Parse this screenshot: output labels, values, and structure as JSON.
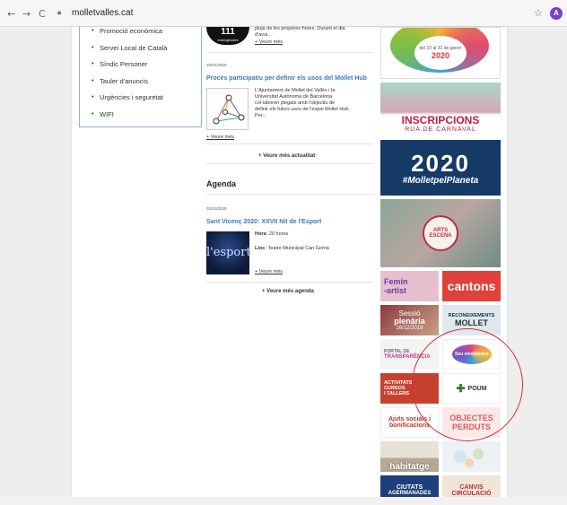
{
  "browser": {
    "url": "molletvalles.cat",
    "avatar_initial": "A",
    "back_icon": "←",
    "forward_icon": "→",
    "reload_icon": "C",
    "star_icon": "☆"
  },
  "leftmenu": {
    "items": [
      {
        "label": "Promoció econòmica"
      },
      {
        "label": "Servei Local de Català"
      },
      {
        "label": "Síndic Personer"
      },
      {
        "label": "Tauler d'anuncis"
      },
      {
        "label": "Urgències i seguretat"
      },
      {
        "label": "WIFI"
      }
    ]
  },
  "news": {
    "top_item": {
      "thumb_text": "111",
      "thumb_sub": "emergències",
      "excerpt_line1": "pluja de les properes hores. Durant el dia",
      "excerpt_line2": "d'avui...",
      "more": "+ Veure més"
    },
    "item2": {
      "date": "20/01/2020",
      "title": "Procés participatiu per definir els usos del Mollet Hub",
      "excerpt": [
        "L'Ajuntament de Mollet del Vallès i la",
        "Universitat Autònoma de Barcelona",
        "col·laboren plegats amb l'objectiu de",
        "definir els futurs usos de l'espai Mollet Hub.",
        "Per..."
      ],
      "more": "+ Veure més"
    },
    "all_news": "+ Veure més actualitat"
  },
  "agenda": {
    "heading": "Agenda",
    "date": "01/01/2020",
    "title": "Sant Vicenç 2020: XXVII Nit de l'Esport",
    "hora_label": "Hora:",
    "hora_value": "20 hores",
    "lloc_label": "Lloc:",
    "lloc_value": "Teatre Municipal Can Gomà",
    "thumb_text": "l'esport",
    "more": "+ Veure més",
    "all_agenda": "+ Veure més agenda"
  },
  "banners": {
    "top": {
      "line1": "del 10 al 31 de gener",
      "line2": "2020"
    },
    "carnaval": {
      "line1": "INSCRIPCIONS",
      "line2": "RUA DE CARNAVAL"
    },
    "planeta": {
      "line1": "2020",
      "line2": "#MolletpelPlaneta"
    },
    "escena": {
      "line1": "ARTS",
      "line2": "ESCENA"
    },
    "femin": {
      "line1": "Femin",
      "line2": "-artist"
    },
    "cantons": {
      "text": "cantons"
    },
    "sessio": {
      "line1": "Sessió",
      "line2": "plenària",
      "line3": "16/12/2019"
    },
    "reconeixements": {
      "line1": "RECONEIXEMENTS",
      "line2": "MOLLET"
    },
    "portal": {
      "line1": "PORTAL DE",
      "line2": "TRANSPARÈNCIA"
    },
    "seu": {
      "text": "Seu electrònica"
    },
    "activitats": {
      "line1": "ACTIVITATS",
      "line2": "CURSOS",
      "line3": "I TALLERS"
    },
    "poum": {
      "text": "POUM"
    },
    "ajuts": {
      "line1": "Ajuts socials i",
      "line2": "bonificacions"
    },
    "objectes": {
      "line1": "OBJECTES",
      "line2": "PERDUTS"
    },
    "habitatge": {
      "text": "habitatge"
    },
    "ciutats": {
      "line1": "CIUTATS",
      "line2": "AGERMANADES"
    },
    "canvis": {
      "line1": "CANVIS",
      "line2": "CIRCULACIÓ"
    }
  }
}
